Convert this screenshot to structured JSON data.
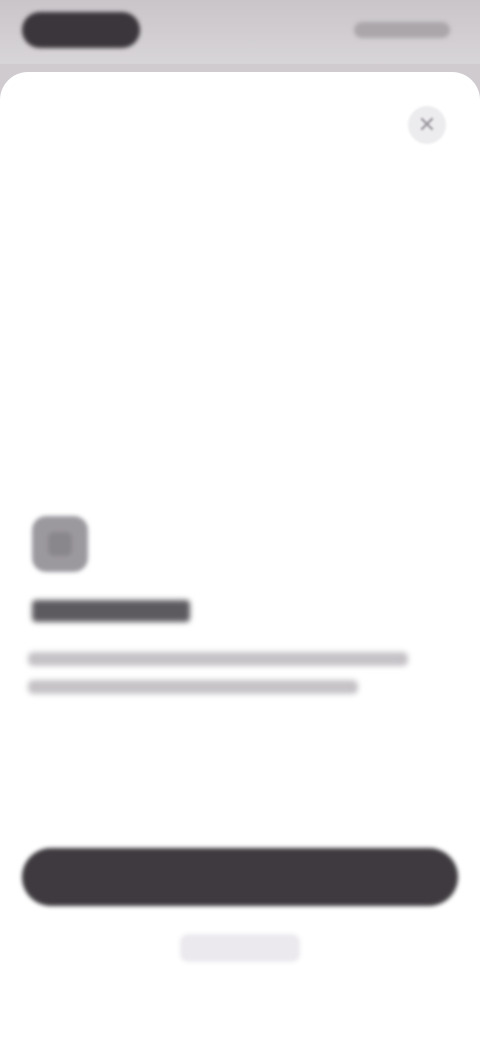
{
  "status_bar": {
    "time": "",
    "indicators": ""
  },
  "sheet": {
    "close_icon": "close-icon",
    "feature_icon": "feature-icon",
    "title": "",
    "description_lines": [
      "",
      ""
    ],
    "primary_button_label": "",
    "secondary_link_label": ""
  },
  "colors": {
    "background": "#cfcbcf",
    "sheet": "#ffffff",
    "primary_button": "#3e3a3f"
  }
}
